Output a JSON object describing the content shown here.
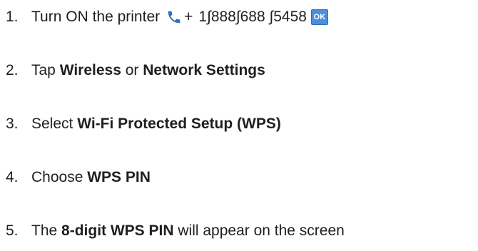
{
  "steps": [
    {
      "number": "1.",
      "text": "Turn ON the printer",
      "plus": "+",
      "phone": "1∫888∫688 ∫5458",
      "icon": "phone-icon",
      "badge": "OK"
    },
    {
      "number": "2.",
      "prefix": "Tap ",
      "bold1": "Wireless",
      "middle": " or ",
      "bold2": "Network Settings"
    },
    {
      "number": "3.",
      "prefix": "Select ",
      "bold1": "Wi-Fi Protected Setup (WPS)"
    },
    {
      "number": "4.",
      "prefix": "Choose ",
      "bold1": "WPS PIN"
    },
    {
      "number": "5.",
      "prefix": "The ",
      "bold1": "8-digit WPS PIN",
      "suffix": " will appear on the screen"
    }
  ],
  "colors": {
    "text": "#1f1f1f",
    "phone_icon": "#2f6fb5",
    "ok_badge": "#4a90d9"
  }
}
